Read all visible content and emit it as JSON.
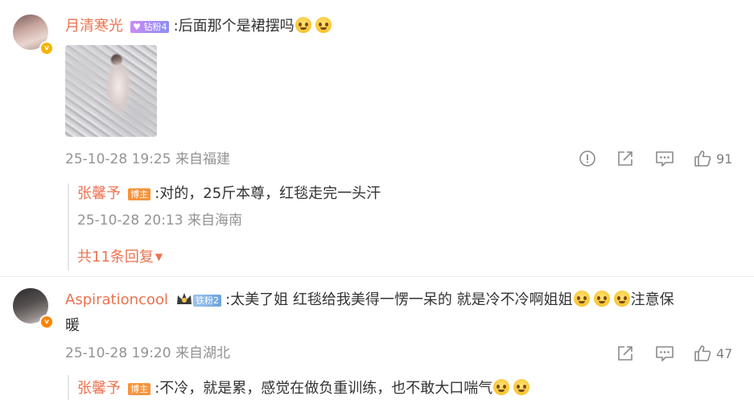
{
  "comments": [
    {
      "username": "月清寒光",
      "badge": "钻粉4",
      "text": ":后面那个是裙摆吗",
      "emoji": [
        "crying-face",
        "crying-face"
      ],
      "has_image": true,
      "timestamp": "25-10-28 19:25",
      "location": "来自福建",
      "like_count": "91",
      "reply": {
        "username": "张馨予",
        "badge": "博主",
        "text": ":对的，25斤本尊，红毯走完一头汗",
        "timestamp": "25-10-28 20:13",
        "location": "来自海南"
      },
      "more_replies": "共11条回复"
    },
    {
      "username": "Aspirationcool",
      "badge": "铁粉2",
      "text_part1": ":太美了姐 红毯给我美得一愣一呆的 就是冷不冷啊姐姐",
      "text_part2": "注意保",
      "text_line2": "暖",
      "emoji": [
        "crying-face",
        "crying-face",
        "crying-face"
      ],
      "timestamp": "25-10-28 19:20",
      "location": "来自湖北",
      "like_count": "47",
      "reply": {
        "username": "张馨予",
        "badge": "博主",
        "text": ":不冷，就是累，感觉在做负重训练，也不敢大口喘气"
      }
    }
  ],
  "colors": {
    "username": "#eb7350",
    "meta": "#939393",
    "text": "#333333"
  }
}
